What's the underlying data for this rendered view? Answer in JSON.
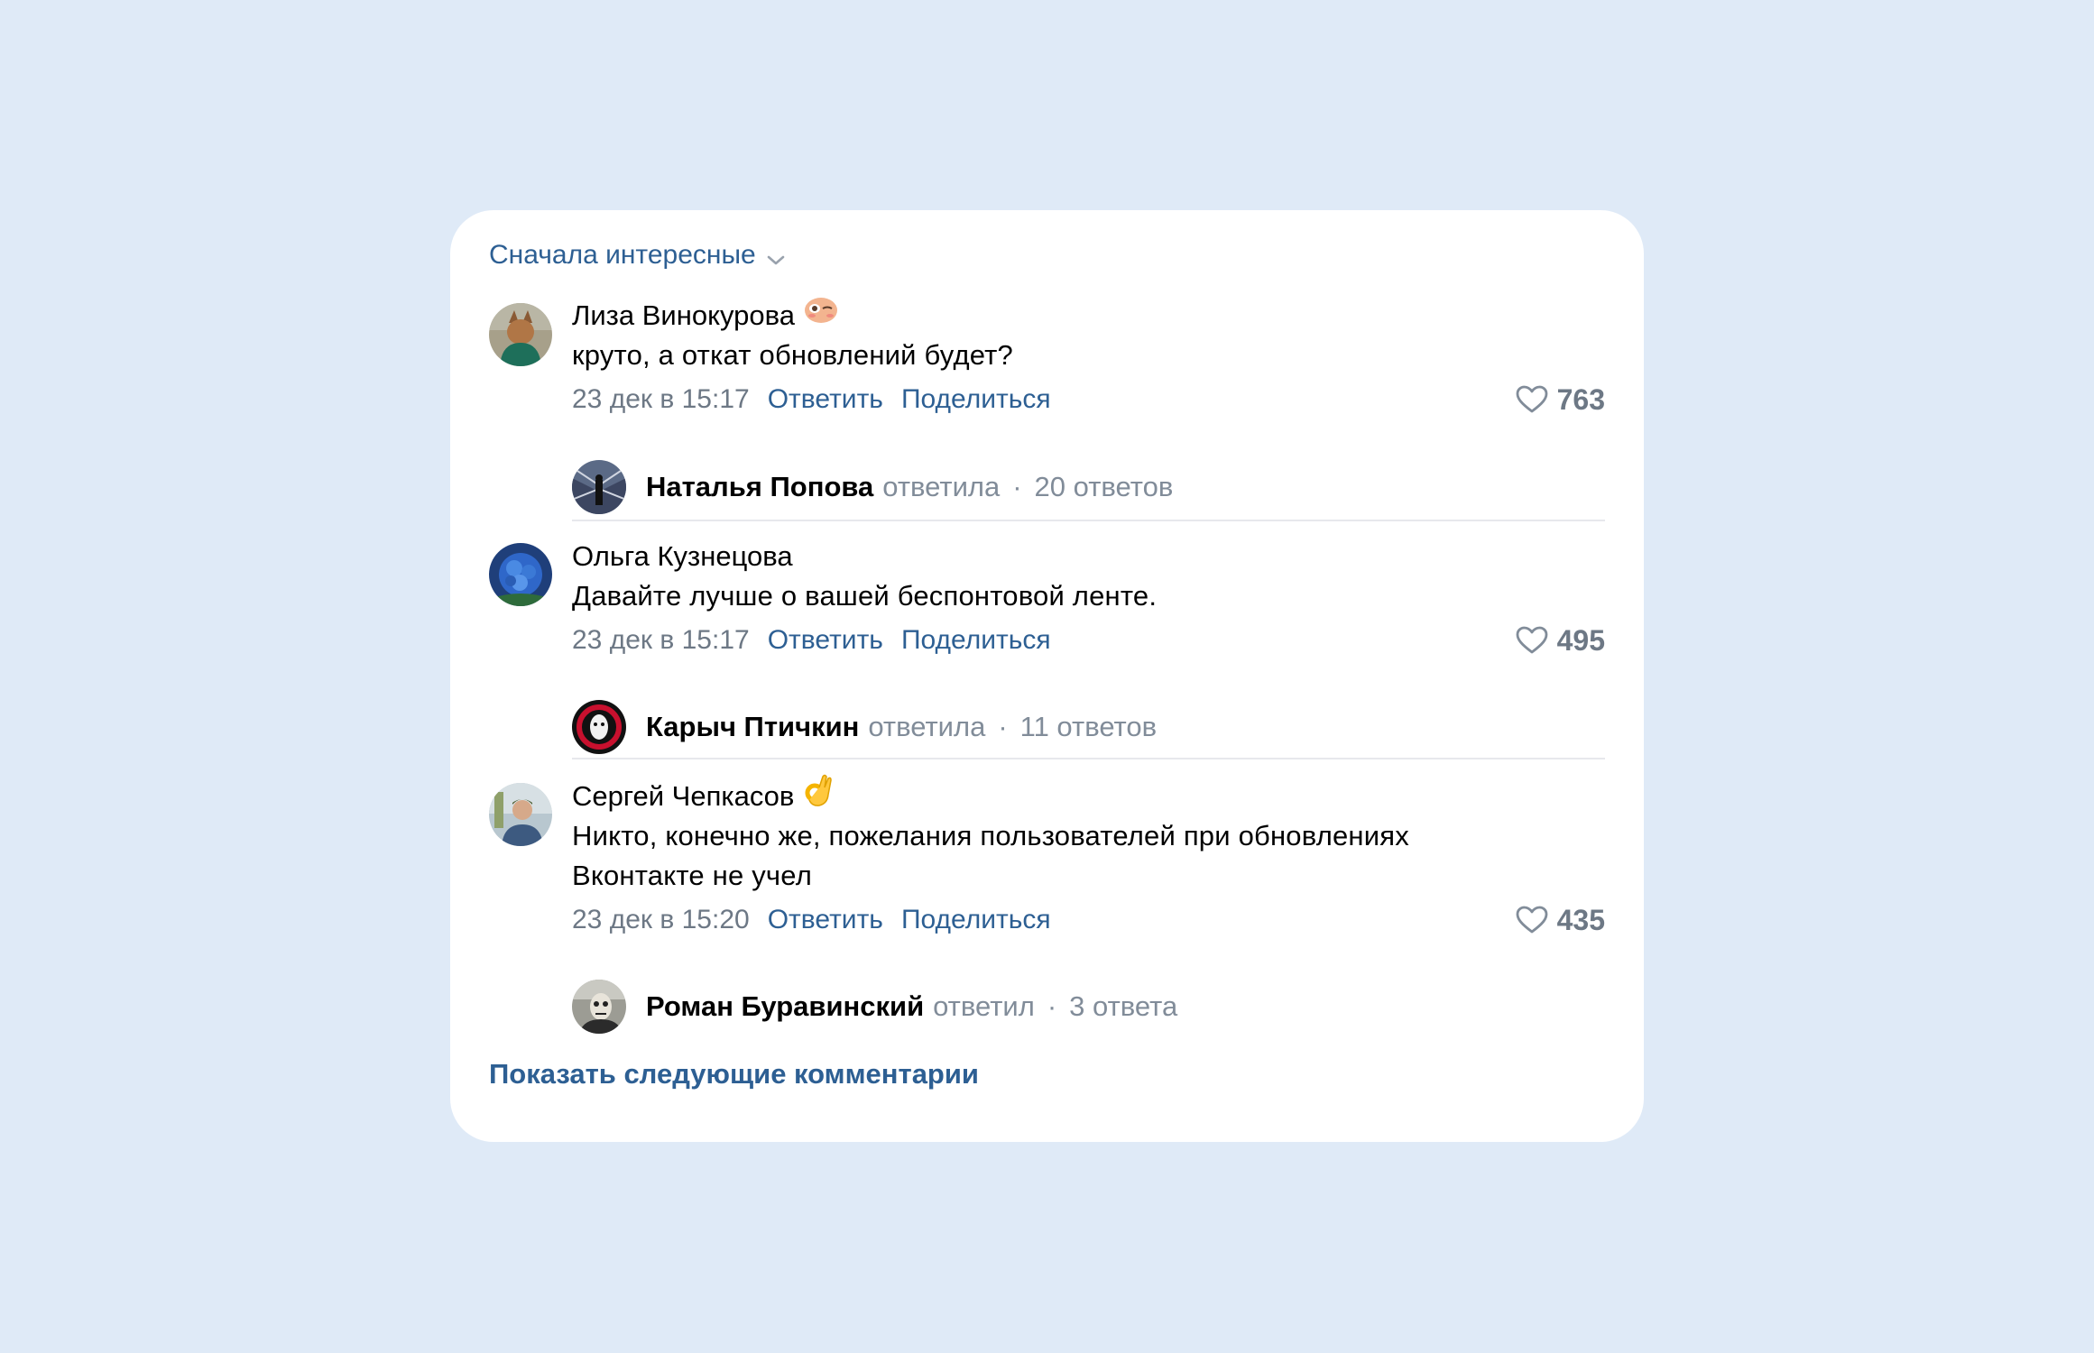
{
  "sort": {
    "label": "Сначала интересные"
  },
  "comments": [
    {
      "author": "Лиза Винокурова",
      "emoji": "winking-face-emoji",
      "text": "круто, а откат обновлений будет?",
      "date": "23 дек в 15:17",
      "reply_label": "Ответить",
      "share_label": "Поделиться",
      "likes": "763",
      "thread": {
        "name": "Наталья Попова",
        "verb": "ответила",
        "count": "20 ответов"
      }
    },
    {
      "author": "Ольга Кузнецова",
      "text": "Давайте лучше о вашей беспонтовой ленте.",
      "date": "23 дек в 15:17",
      "reply_label": "Ответить",
      "share_label": "Поделиться",
      "likes": "495",
      "thread": {
        "name": "Карыч Птичкин",
        "verb": "ответила",
        "count": "11 ответов"
      }
    },
    {
      "author": "Сергей Чепкасов",
      "emoji": "ok-hand-emoji",
      "text_line1": "Никто, конечно же, пожелания пользователей при обновлениях",
      "text_line2": "Вконтакте не учел",
      "date": "23 дек в 15:20",
      "reply_label": "Ответить",
      "share_label": "Поделиться",
      "likes": "435",
      "thread": {
        "name": "Роман Буравинский",
        "verb": "ответил",
        "count": "3 ответа"
      }
    }
  ],
  "show_more": "Показать следующие комментарии",
  "colors": {
    "background": "#dfeaf7",
    "card": "#ffffff",
    "link": "#2d5f93",
    "secondary_text": "#6d7885",
    "divider": "#e7e8ec"
  }
}
